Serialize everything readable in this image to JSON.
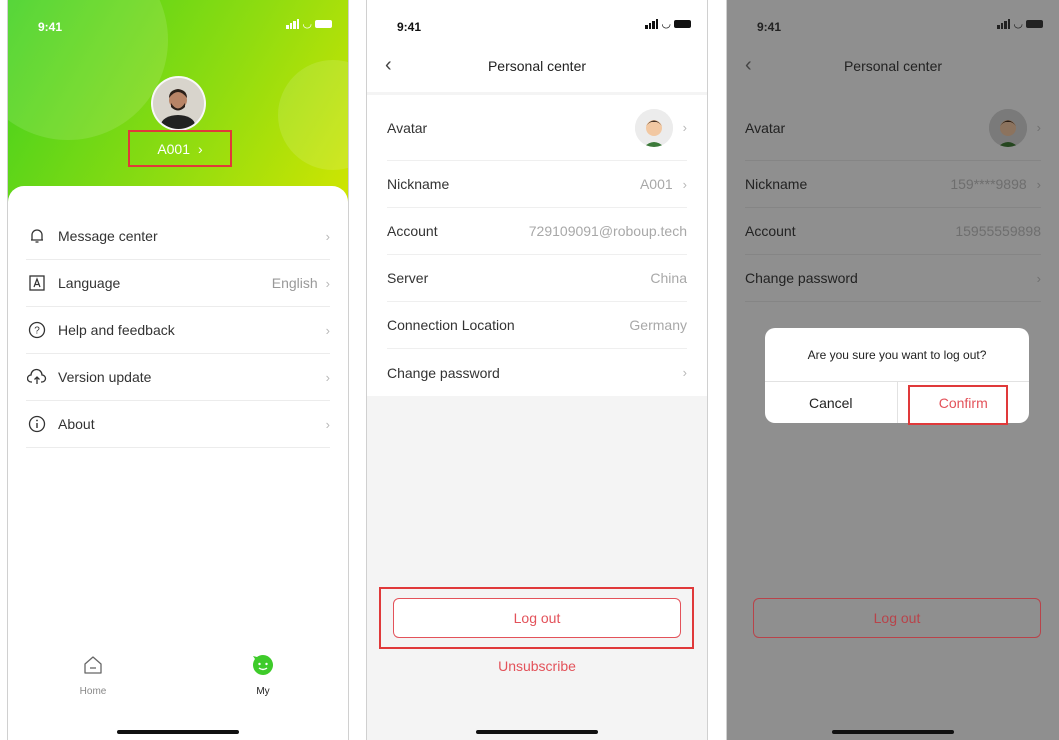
{
  "status": {
    "time": "9:41"
  },
  "screen1": {
    "nickname": "A001",
    "menu": [
      {
        "label": "Message center",
        "value": "",
        "icon": "bell-icon"
      },
      {
        "label": "Language",
        "value": "English",
        "icon": "language-icon"
      },
      {
        "label": "Help and feedback",
        "value": "",
        "icon": "help-icon"
      },
      {
        "label": "Version update",
        "value": "",
        "icon": "cloud-upload-icon"
      },
      {
        "label": "About",
        "value": "",
        "icon": "info-icon"
      }
    ],
    "tabs": [
      {
        "label": "Home",
        "icon": "home-icon"
      },
      {
        "label": "My",
        "icon": "smiley-icon"
      }
    ],
    "colors": {
      "gradient_start": "#3fd11f",
      "gradient_end": "#d5e600",
      "highlight": "#e0393a"
    }
  },
  "screen2": {
    "title": "Personal center",
    "rows": [
      {
        "label": "Avatar",
        "value": ""
      },
      {
        "label": "Nickname",
        "value": "A001"
      },
      {
        "label": "Account",
        "value": "729109091@roboup.tech"
      },
      {
        "label": "Server",
        "value": "China"
      },
      {
        "label": "Connection Location",
        "value": "Germany"
      },
      {
        "label": "Change password",
        "value": ""
      }
    ],
    "logout": "Log out",
    "unsubscribe": "Unsubscribe",
    "accent": "#e3525a"
  },
  "screen3": {
    "title": "Personal center",
    "rows": [
      {
        "label": "Avatar",
        "value": ""
      },
      {
        "label": "Nickname",
        "value": "159****9898"
      },
      {
        "label": "Account",
        "value": "15955559898"
      },
      {
        "label": "Change password",
        "value": ""
      }
    ],
    "dialog": {
      "message": "Are you sure you want to log out?",
      "cancel": "Cancel",
      "confirm": "Confirm"
    },
    "logout": "Log out"
  }
}
